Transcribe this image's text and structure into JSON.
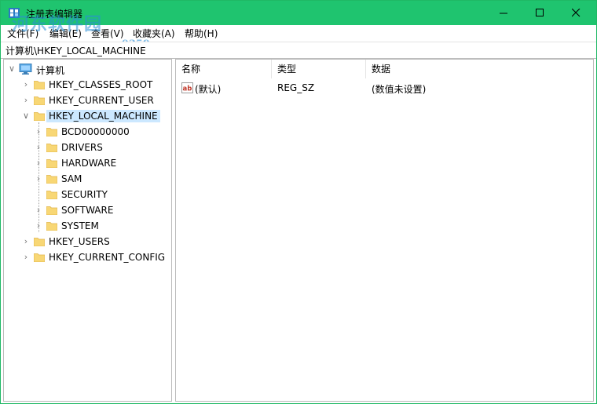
{
  "window": {
    "title": "注册表编辑器"
  },
  "watermark": {
    "site": "河东软件园",
    "url": "www.pc0359.cn"
  },
  "menu": {
    "file": "文件(F)",
    "edit": "编辑(E)",
    "view": "查看(V)",
    "favorites": "收藏夹(A)",
    "help": "帮助(H)"
  },
  "address": "计算机\\HKEY_LOCAL_MACHINE",
  "tree": {
    "root": "计算机",
    "hives": [
      "HKEY_CLASSES_ROOT",
      "HKEY_CURRENT_USER",
      "HKEY_LOCAL_MACHINE",
      "HKEY_USERS",
      "HKEY_CURRENT_CONFIG"
    ],
    "hklm_children": [
      "BCD00000000",
      "DRIVERS",
      "HARDWARE",
      "SAM",
      "SECURITY",
      "SOFTWARE",
      "SYSTEM"
    ],
    "selected": "HKEY_LOCAL_MACHINE"
  },
  "list": {
    "columns": [
      "名称",
      "类型",
      "数据"
    ],
    "rows": [
      {
        "name": "(默认)",
        "type": "REG_SZ",
        "data": "(数值未设置)"
      }
    ]
  },
  "colors": {
    "titlebar": "#1fc46f",
    "selection": "#cce8ff",
    "folder": "#f8d775"
  },
  "icons": {
    "app": "regedit-icon",
    "computer": "computer-icon",
    "folder": "folder-icon",
    "string_value": "ab-string-icon",
    "minimize": "minimize-icon",
    "maximize": "maximize-icon",
    "close": "close-icon"
  }
}
